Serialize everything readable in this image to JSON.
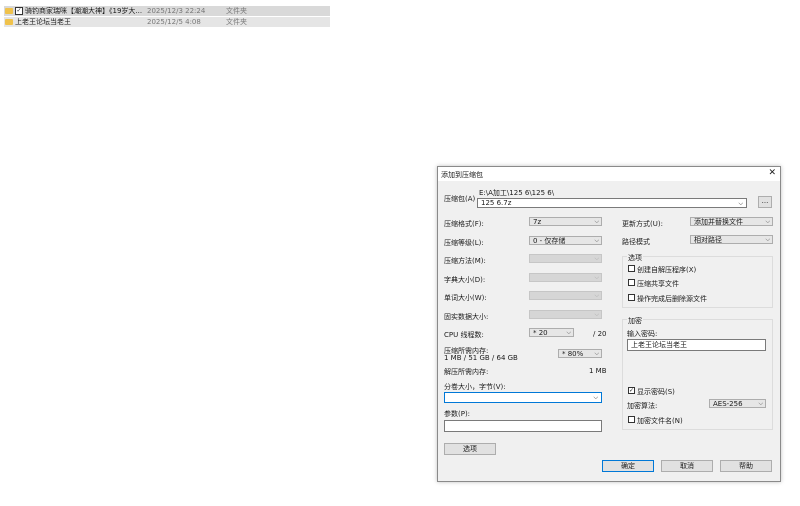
{
  "files": [
    {
      "name": "骑钓商家瑞咪【潮潮大神】《19岁大...",
      "date": "2025/12/3 22:24",
      "type": "文件夹",
      "checked": true
    },
    {
      "name": "上老王论坛当老王",
      "date": "2025/12/5 4:08",
      "type": "文件夹",
      "checked": false
    }
  ],
  "dialog": {
    "title": "添加到压缩包",
    "archive_label": "压缩包(A)",
    "archive_path": "E:\\A加工\\125 6\\125 6\\",
    "archive_name": "125 6.7z",
    "browse_label": "...",
    "format_label": "压缩格式(F):",
    "format_value": "7z",
    "level_label": "压缩等级(L):",
    "level_value": "0 - 仅存储",
    "method_label": "压缩方法(M):",
    "dict_label": "字典大小(D):",
    "word_label": "单词大小(W):",
    "solid_label": "固实数据大小:",
    "cpu_label": "CPU 线程数:",
    "cpu_value": "* 20",
    "cpu_total": "/ 20",
    "mem_comp_label": "压缩所需内存:",
    "mem_comp_values": "1 MB / 51 GB / 64 GB",
    "mem_comp_percent": "* 80%",
    "mem_decomp_label": "解压所需内存:",
    "mem_decomp_value": "1 MB",
    "split_label": "分卷大小，字节(V):",
    "params_label": "参数(P):",
    "options_button": "选项",
    "update_label": "更新方式(U):",
    "update_value": "添加并替换文件",
    "path_label": "路径模式",
    "path_value": "相对路径",
    "options_group": "选项",
    "opt_sfx": "创建自解压程序(X)",
    "opt_shared": "压缩共享文件",
    "opt_delete": "操作完成后删除源文件",
    "encrypt_group": "加密",
    "password_label": "输入密码:",
    "password_value": "上老王论坛当老王",
    "show_password": "显示密码(S)",
    "enc_method_label": "加密算法:",
    "enc_method_value": "AES-256",
    "enc_names": "加密文件名(N)",
    "ok": "确定",
    "cancel": "取消",
    "help": "帮助"
  },
  "colors": {
    "accent": "#0078d7",
    "folder": "#f0c24b"
  }
}
